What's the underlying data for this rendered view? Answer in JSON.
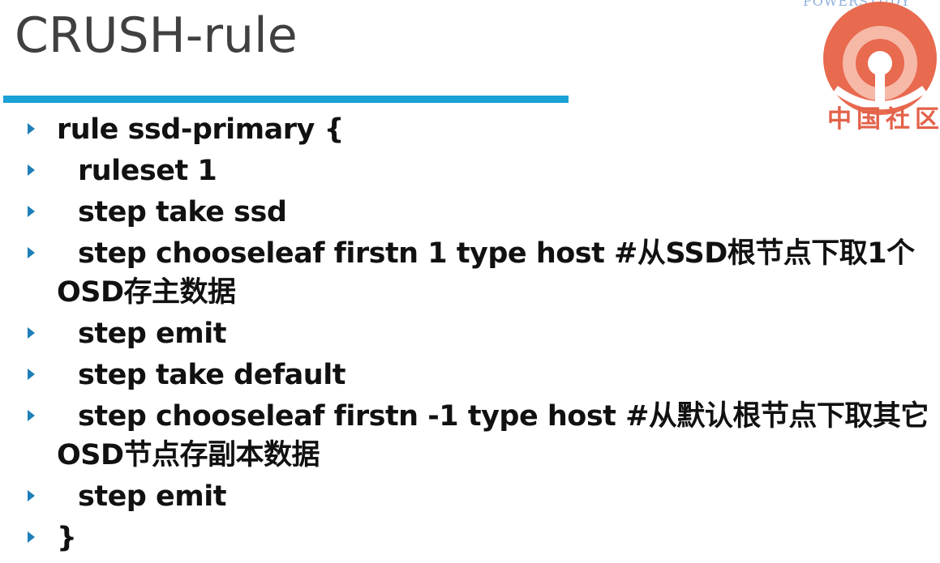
{
  "slide": {
    "title": "CRUSH-rule"
  },
  "logo": {
    "top_text": "POWERSTUDY",
    "cn_text": "中国社区"
  },
  "code_lines": [
    {
      "text": "rule ssd-primary {",
      "indent": false
    },
    {
      "text": "ruleset 1",
      "indent": true
    },
    {
      "text": "step take ssd",
      "indent": true
    },
    {
      "text": "step chooseleaf firstn 1 type host #从SSD根节点下取1个OSD存主数据",
      "indent": true
    },
    {
      "text": "step emit",
      "indent": true
    },
    {
      "text": "step take default",
      "indent": true
    },
    {
      "text": "step chooseleaf firstn -1 type host #从默认根节点下取其它OSD节点存副本数据",
      "indent": true
    },
    {
      "text": "step emit",
      "indent": true
    },
    {
      "text": "}",
      "indent": false
    }
  ],
  "colors": {
    "title": "#404040",
    "rule_bar": "#1aa1d6",
    "bullet": "#1f7fb8",
    "logo_red": "#e3624a"
  }
}
